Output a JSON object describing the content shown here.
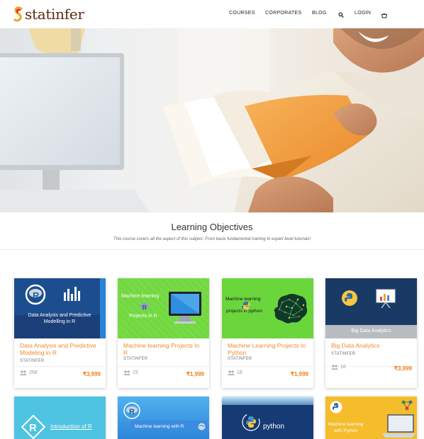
{
  "brand": {
    "name": "statinfer"
  },
  "nav": {
    "courses": "COURSES",
    "corporates": "CORPORATES",
    "blog": "BLOG",
    "login": "LOGIN"
  },
  "objectives": {
    "title": "Learning Objectives",
    "subtitle": "This course covers all the aspect of this subject. From basic fundamental training to expert level tutorials!"
  },
  "courses": [
    {
      "title": "Data Analysis and Predictive Modeling in R",
      "author": "STATINFER",
      "students": "258",
      "price": "₹3,999",
      "image_text": "Data Analysis and Predictive Modelling in R",
      "image_letter": "R"
    },
    {
      "title": "Machine learning Projects In R",
      "author": "STATINFER",
      "students": "23",
      "price": "₹1,999",
      "image_text_1": "Machine learning",
      "image_text_2": "Projects in R",
      "image_letter": "R"
    },
    {
      "title": "Machine Learning Projects In Python",
      "author": "STATINFER",
      "students": "18",
      "price": "₹1,999",
      "image_text_1": "Machine learning",
      "image_text_2": "projects in python"
    },
    {
      "title": "Big Data Analytics",
      "author": "STATINFER",
      "students": "16",
      "price": "₹3,999",
      "image_text": "Big Data Analytics"
    }
  ],
  "courses_row2": [
    {
      "image_text": "Introduction of R",
      "image_letter": "R"
    },
    {
      "image_text": "Machine learning with R",
      "image_letter": "R"
    },
    {
      "image_text": "python"
    },
    {
      "image_text_1": "Machine learning",
      "image_text_2": "with Python"
    }
  ],
  "colors": {
    "accent": "#ef7f1a",
    "brand_text": "#5a2c12",
    "green_card": "#6fd63f",
    "navy_card": "#1a3a66"
  }
}
